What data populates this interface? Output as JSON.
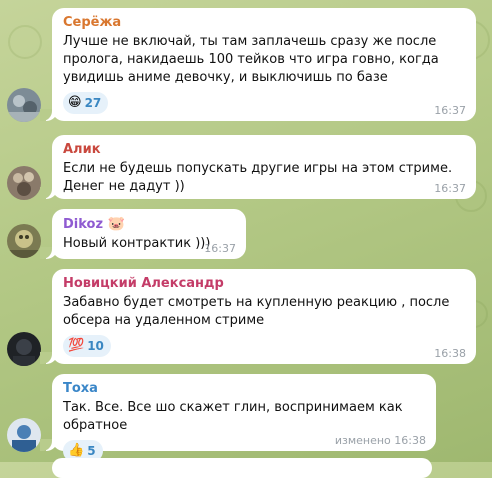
{
  "messages": [
    {
      "author": "Серёжа",
      "author_color": "#d9772f",
      "text": "Лучше не включай, ты там заплачешь сразу же после пролога, накидаешь 100 тейков что игра говно, когда увидишь аниме девочку, и выключишь по базе",
      "reaction": {
        "emoji": "😁",
        "count": "27"
      },
      "time": "16:37",
      "edited": ""
    },
    {
      "author": "Алик",
      "author_color": "#c9483e",
      "text": "Если не будешь попускать другие игры на этом стриме. Денег не дадут ))",
      "time": "16:37",
      "edited": ""
    },
    {
      "author": "Dikoz",
      "author_color": "#8f5bd1",
      "badge_emoji": "🐷",
      "text": "Новый контрактик )))",
      "time": "16:37",
      "edited": ""
    },
    {
      "author": "Новицкий Александр",
      "author_color": "#c43c68",
      "text": "Забавно будет смотреть на купленную реакцию , после обсера на удаленном стриме",
      "reaction": {
        "emoji": "💯",
        "count": "10"
      },
      "time": "16:38",
      "edited": ""
    },
    {
      "author": "Тоха",
      "author_color": "#3a86c8",
      "text": "Так. Все. Все шо скажет глин, воспринимаем как обратное",
      "reaction": {
        "emoji": "👍",
        "count": "5"
      },
      "time": "16:38",
      "edited": "изменено"
    }
  ],
  "colors": {
    "bubble_bg": "#ffffff",
    "reaction_bg": "#e6f1fa",
    "reaction_count": "#3a87c2",
    "time_text": "#9aa1a8",
    "wallpaper": "#b3c885"
  }
}
